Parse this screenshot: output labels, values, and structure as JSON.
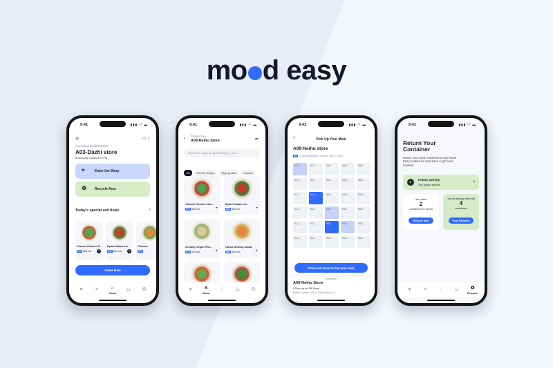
{
  "logo": {
    "pre": "mo",
    "post": "d easy"
  },
  "status_time": "9:41",
  "status_icons": "▮▮▮ ◠ ▬",
  "tabs": [
    "Favorites",
    "Menu",
    "Home",
    "Cart",
    "Recycle"
  ],
  "home": {
    "subtitle": "Your usual breakfast spot",
    "store": "A03-Dazhi store",
    "status": "● Not busy Closes 8:00 PM",
    "enter": "Enter the Shop",
    "recycle": "Recycle Now",
    "specials_title": "Today's special and deals",
    "items": [
      {
        "name": "Classic Chicken S...",
        "price": "$75",
        "cal": "500 cal."
      },
      {
        "name": "Eybisi Salad mix",
        "price": "$65",
        "cal": "500 cal."
      },
      {
        "name": "Chicken",
        "price": "$70",
        "cal": ""
      }
    ],
    "order": "Order Now",
    "active_tab": "Home"
  },
  "menu": {
    "pickup_label": "Pickup from",
    "store": "A09-Neihu Store",
    "search_placeholder": "Search for meals or ingredients(e.g., avoc...",
    "filters": [
      "All",
      "Recent Orders",
      "High-protein",
      "Popular"
    ],
    "items": [
      {
        "name": "Classic Chicken Sal...",
        "price": "$75",
        "cal": "500 cal."
      },
      {
        "name": "Eybisi Salad mix",
        "price": "$95",
        "cal": "500 cal."
      },
      {
        "name": "Creamy Vegan Pas...",
        "price": "$75",
        "cal": "370 cal."
      },
      {
        "name": "Citrus Shrimp Salad",
        "price": "$60",
        "cal": "300 cal."
      }
    ],
    "active_tab": "Menu"
  },
  "pickup": {
    "title": "Pick Up Your Meal",
    "store": "A09-Neihu store",
    "legend": [
      {
        "tag": "A/1",
        "label": "Completed"
      },
      {
        "tag": "A/1",
        "label": "In Progress"
      },
      {
        "tag": "A/1",
        "label": "In Order"
      }
    ],
    "cells": [
      "01-5",
      "02-5",
      "03-5",
      "04-5",
      "05-5",
      "01-4",
      "02-4",
      "03-4",
      "04-4",
      "05-4",
      "01-3",
      "02-4",
      "03-4",
      "04-4",
      "05-4",
      "01-3",
      "02-3",
      "03-3",
      "04-3",
      "05-3",
      "01-2",
      "02-2",
      "03-2",
      "04-2",
      "05-2",
      "01-1",
      "02-1",
      "03-1",
      "04-1",
      "05-1"
    ],
    "hint": "Pinch and zoom to find your meal",
    "footer_store": "A09-Neihu Store",
    "footer_time": "• Pick-up at: 08:15am",
    "footer_loc": "Meal Location: 03-3  Order #208474"
  },
  "recycle": {
    "title": "Return Your Container",
    "desc": "Return your used containers at any Mood Easy location for cash back or gift card rewards.",
    "points_title": "Points activity",
    "points_value": "140 points earned",
    "have_label": "You have",
    "have_count": "2",
    "have_sub": "containers to return",
    "returned_label": "You've already returned",
    "returned_count": "4",
    "returned_sub": "containers",
    "btn_recycle": "Recycle Now",
    "btn_rewards": "View Rewards",
    "active_tab": "Recycle"
  }
}
